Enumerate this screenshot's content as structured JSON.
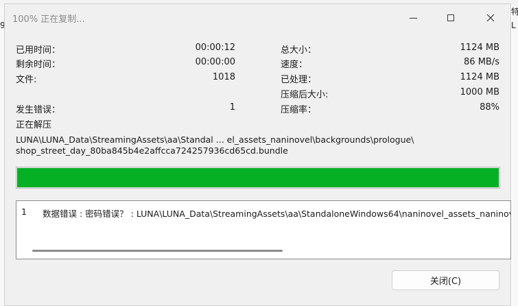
{
  "background": {
    "frag_left": "9",
    "frag_right_top": "特",
    "frag_right_mid": "L"
  },
  "window": {
    "title": "100% 正在复制...",
    "close_icon": "close-icon",
    "minimize_icon": "minimize-icon",
    "maximize_icon": "maximize-icon"
  },
  "stats_left": [
    {
      "label": "已用时间：",
      "value": "00:00:12"
    },
    {
      "label": "剩余时间：",
      "value": "00:00:00"
    },
    {
      "label": "文件:",
      "value": "1018"
    },
    {
      "label": "发生错误：",
      "value": "1"
    }
  ],
  "stats_right": [
    {
      "label": "总大小：",
      "value": "1124 MB"
    },
    {
      "label": "速度：",
      "value": "86 MB/s"
    },
    {
      "label": "已处理：",
      "value": "1124 MB"
    },
    {
      "label": "压缩后大小:",
      "value": "1000 MB"
    },
    {
      "label": "压缩率：",
      "value": "88%"
    }
  ],
  "status": "正在解压",
  "current_path_line1": "LUNA\\LUNA_Data\\StreamingAssets\\aa\\Standal ... el_assets_naninovel\\backgrounds\\prologue\\",
  "current_path_line2": "shop_street_day_80ba845b4e2affcca724257936cd65cd.bundle",
  "progress": {
    "percent": 100,
    "color": "#06b025"
  },
  "log": [
    {
      "num": "1",
      "text": "数据错误 : 密码错误？ : LUNA\\LUNA_Data\\StreamingAssets\\aa\\StandaloneWindows64\\naninovel_assets_naninovel"
    }
  ],
  "buttons": {
    "close": "关闭(C)"
  }
}
